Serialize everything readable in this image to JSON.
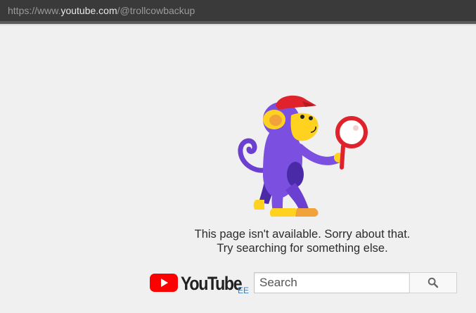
{
  "browser": {
    "url_prefix": "https://www.",
    "url_host": "youtube.com",
    "url_path": "/@trollcowbackup"
  },
  "illustration": {
    "icon": "monkey-with-magnifying-glass-icon"
  },
  "error": {
    "line1": "This page isn't available. Sorry about that.",
    "line2": "Try searching for something else."
  },
  "footer": {
    "logo_text": "YouTube",
    "region": "EE",
    "search_placeholder": "Search",
    "search_icon": "search-icon"
  },
  "colors": {
    "youtube_red": "#ff0000",
    "page_bg": "#f0f0f0",
    "region_link": "#3b7bbf"
  }
}
